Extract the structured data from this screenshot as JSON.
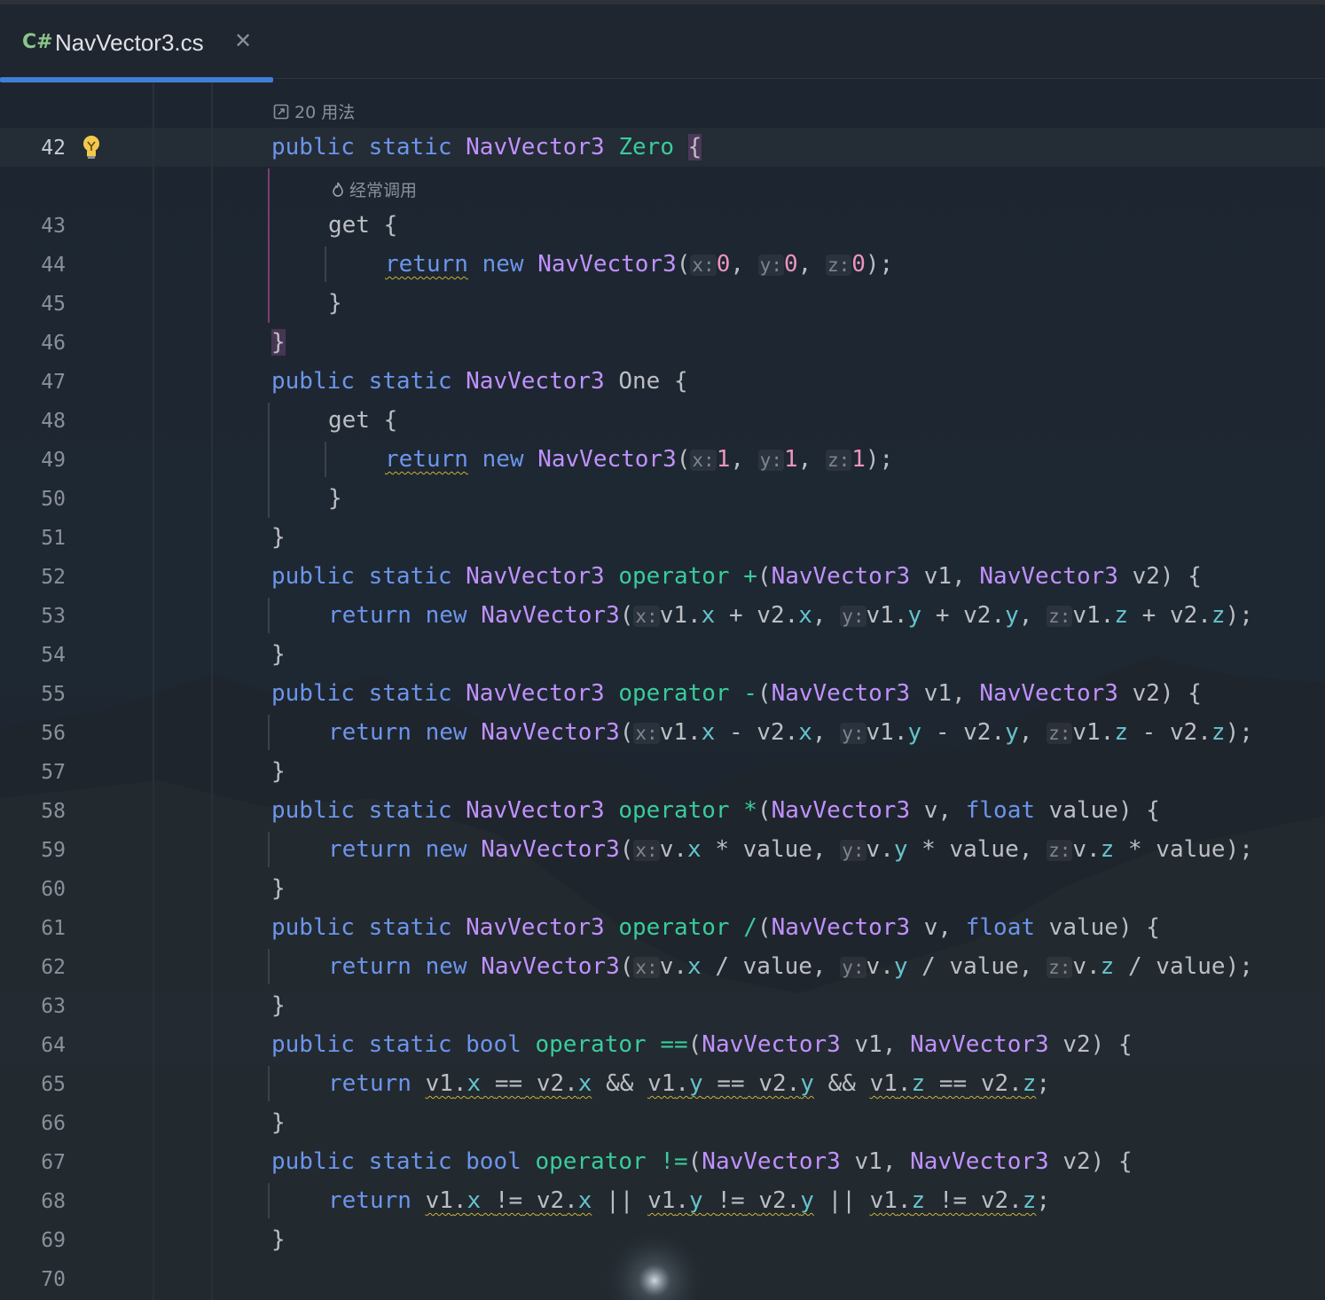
{
  "tab": {
    "icon": "C#",
    "label": "NavVector3.cs",
    "close": "✕"
  },
  "usages": "20 用法",
  "frequent": "经常调用",
  "lines": [
    "42",
    "43",
    "44",
    "45",
    "46",
    "47",
    "48",
    "49",
    "50",
    "51",
    "52",
    "53",
    "54",
    "55",
    "56",
    "57",
    "58",
    "59",
    "60",
    "61",
    "62",
    "63",
    "64",
    "65",
    "66",
    "67",
    "68",
    "69",
    "70"
  ],
  "colors": {
    "accent": "#3f7fd8",
    "keyword": "#6c95eb",
    "type": "#c191ff",
    "member": "#39cc9b",
    "number": "#ed94c0",
    "field": "#66c3cc"
  },
  "tokens": {
    "public": "public",
    "static": "static",
    "ret": "return",
    "new": "new",
    "get": "get",
    "bool": "bool",
    "float": "float",
    "op": "operator",
    "type": "NavVector3",
    "zero": "Zero",
    "one": "One",
    "hx": "x:",
    "hy": "y:",
    "hz": "z:",
    "n0": "0",
    "n1": "1",
    "v1": "v1",
    "v2": "v2",
    "v": "v",
    "value": "value",
    "fx": "x",
    "fy": "y",
    "fz": "z",
    "plus": "+",
    "minus": "-",
    "star": "*",
    "slash": "/",
    "eq": "==",
    "ne": "!=",
    "and": "&&",
    "or": "||",
    "lbrace": "{",
    "rbrace": "}"
  }
}
